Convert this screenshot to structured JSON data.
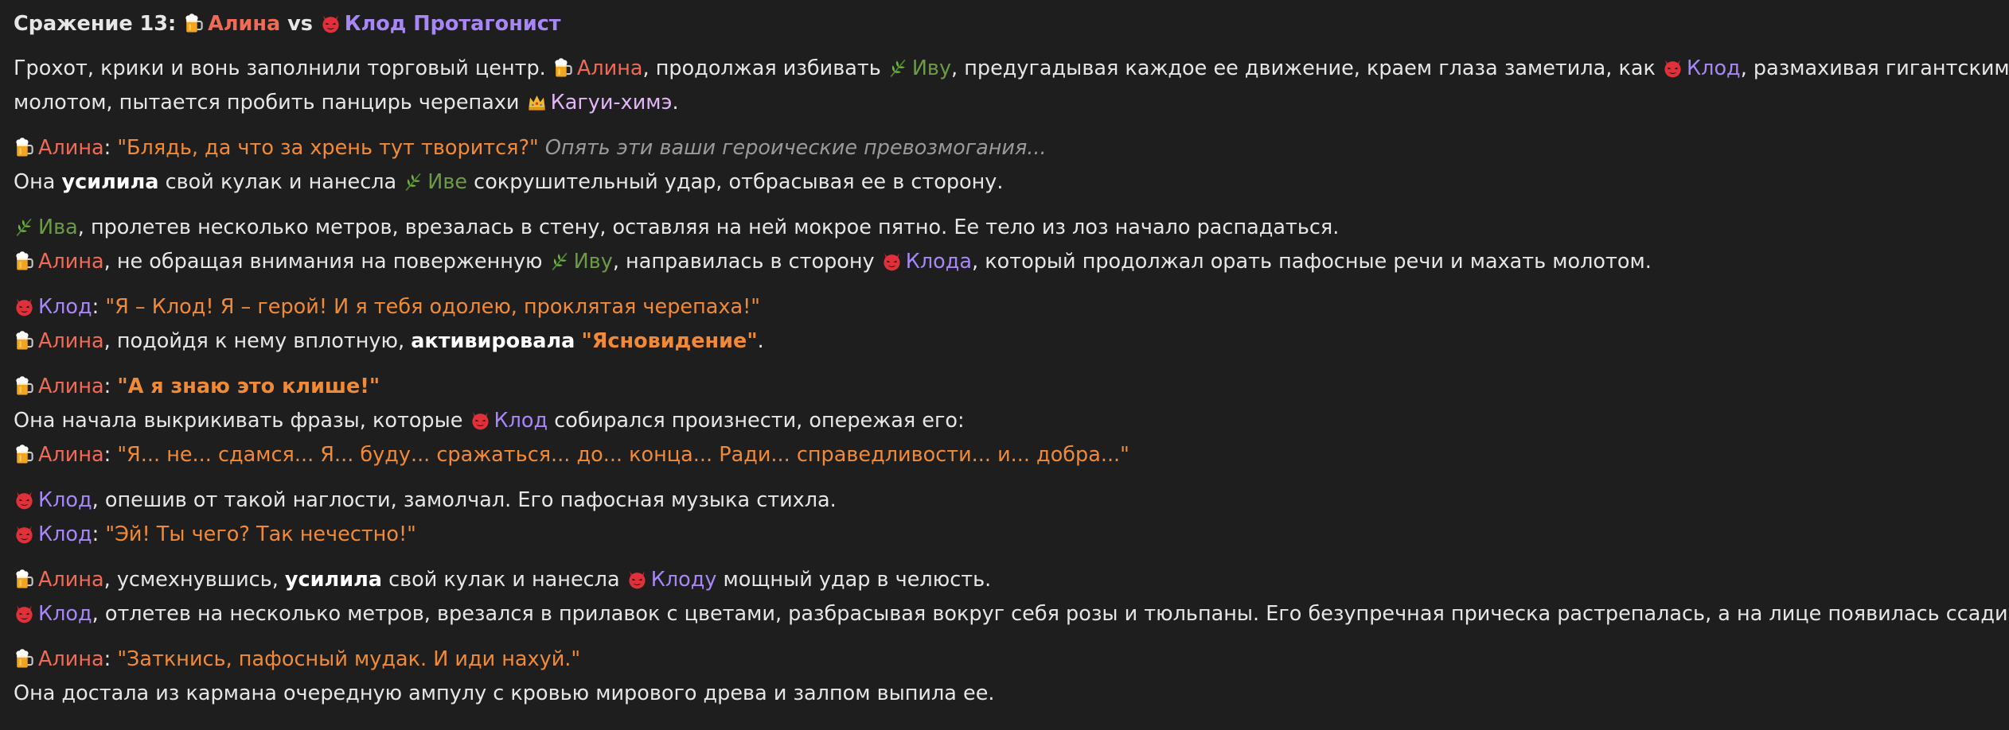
{
  "colors": {
    "background": "#1e1e1f",
    "text": "#e6e6e6",
    "alina": "#f06a55",
    "klod": "#a787f5",
    "iva": "#6d9a46",
    "kaguya": "#e2b5f5",
    "quote": "#f08a36",
    "thought": "#9a9a9a"
  },
  "icons": {
    "alina": "beer-mug-icon",
    "klod": "red-devil-icon",
    "iva": "leaf-icon",
    "kaguya": "crown-icon"
  },
  "battle": {
    "title_prefix": "Сражение 13: ",
    "fighter1": "Алина",
    "vs": " vs ",
    "fighter2": "Клод Протагонист"
  },
  "paragraphs": [
    [
      [
        {
          "t": "text",
          "v": "Грохот, крики и вонь заполнили торговый центр. "
        },
        {
          "t": "alina",
          "v": "Алина"
        },
        {
          "t": "text",
          "v": ", продолжая избивать "
        },
        {
          "t": "iva",
          "v": "Иву"
        },
        {
          "t": "text",
          "v": ", предугадывая каждое ее движение, краем глаза заметила, как "
        },
        {
          "t": "klod",
          "v": "Клод"
        },
        {
          "t": "text",
          "v": ", размахивая гигантским"
        }
      ],
      [
        {
          "t": "text",
          "v": "молотом, пытается пробить панцирь черепахи "
        },
        {
          "t": "kaguya",
          "v": "Кагуи-химэ"
        },
        {
          "t": "text",
          "v": "."
        }
      ]
    ],
    [
      [
        {
          "t": "alina",
          "v": "Алина"
        },
        {
          "t": "text",
          "v": ": "
        },
        {
          "t": "quote",
          "v": "\"Блядь, да что за хрень тут творится?\""
        },
        {
          "t": "text",
          "v": " "
        },
        {
          "t": "thought",
          "v": "Опять эти ваши героические превозмогания..."
        }
      ],
      [
        {
          "t": "text",
          "v": "Она "
        },
        {
          "t": "bold",
          "v": "усилила"
        },
        {
          "t": "text",
          "v": " свой кулак и нанесла "
        },
        {
          "t": "iva",
          "v": "Иве"
        },
        {
          "t": "text",
          "v": " сокрушительный удар, отбрасывая ее в сторону."
        }
      ]
    ],
    [
      [
        {
          "t": "iva",
          "v": "Ива"
        },
        {
          "t": "text",
          "v": ", пролетев несколько метров, врезалась в стену, оставляя на ней мокрое пятно. Ее тело из лоз начало распадаться."
        }
      ],
      [
        {
          "t": "alina",
          "v": "Алина"
        },
        {
          "t": "text",
          "v": ", не обращая внимания на поверженную "
        },
        {
          "t": "iva",
          "v": "Иву"
        },
        {
          "t": "text",
          "v": ", направилась в сторону "
        },
        {
          "t": "klod",
          "v": "Клода"
        },
        {
          "t": "text",
          "v": ", который продолжал орать пафосные речи и махать молотом."
        }
      ]
    ],
    [
      [
        {
          "t": "klod",
          "v": "Клод"
        },
        {
          "t": "text",
          "v": ": "
        },
        {
          "t": "quote",
          "v": "\"Я – Клод! Я – герой! И я тебя одолею, проклятая черепаха!\""
        }
      ],
      [
        {
          "t": "alina",
          "v": "Алина"
        },
        {
          "t": "text",
          "v": ", подойдя к нему вплотную, "
        },
        {
          "t": "bold",
          "v": "активировала"
        },
        {
          "t": "text",
          "v": " "
        },
        {
          "t": "bq",
          "v": "\"Ясновидение\""
        },
        {
          "t": "text",
          "v": "."
        }
      ]
    ],
    [
      [
        {
          "t": "alina",
          "v": "Алина"
        },
        {
          "t": "text",
          "v": ": "
        },
        {
          "t": "bq",
          "v": "\"А я знаю это клише!\""
        }
      ],
      [
        {
          "t": "text",
          "v": "Она начала выкрикивать фразы, которые "
        },
        {
          "t": "klod",
          "v": "Клод"
        },
        {
          "t": "text",
          "v": " собирался произнести, опережая его:"
        }
      ],
      [
        {
          "t": "alina",
          "v": "Алина"
        },
        {
          "t": "text",
          "v": ": "
        },
        {
          "t": "quote",
          "v": "\"Я... не... сдамся... Я... буду... сражаться... до... конца... Ради... справедливости... и... добра...\""
        }
      ]
    ],
    [
      [
        {
          "t": "klod",
          "v": "Клод"
        },
        {
          "t": "text",
          "v": ", опешив от такой наглости, замолчал. Его пафосная музыка стихла."
        }
      ],
      [
        {
          "t": "klod",
          "v": "Клод"
        },
        {
          "t": "text",
          "v": ": "
        },
        {
          "t": "quote",
          "v": "\"Эй! Ты чего? Так нечестно!\""
        }
      ]
    ],
    [
      [
        {
          "t": "alina",
          "v": "Алина"
        },
        {
          "t": "text",
          "v": ", усмехнувшись, "
        },
        {
          "t": "bold",
          "v": "усилила"
        },
        {
          "t": "text",
          "v": " свой кулак и нанесла "
        },
        {
          "t": "klod",
          "v": "Клоду"
        },
        {
          "t": "text",
          "v": " мощный удар в челюсть."
        }
      ],
      [
        {
          "t": "klod",
          "v": "Клод"
        },
        {
          "t": "text",
          "v": ", отлетев на несколько метров, врезался в прилавок с цветами, разбрасывая вокруг себя розы и тюльпаны. Его безупречная прическа растрепалась, а на лице появилась ссадина."
        }
      ]
    ],
    [
      [
        {
          "t": "alina",
          "v": "Алина"
        },
        {
          "t": "text",
          "v": ": "
        },
        {
          "t": "quote",
          "v": "\"Заткнись, пафосный мудак. И иди нахуй.\""
        }
      ],
      [
        {
          "t": "text",
          "v": "Она достала из кармана очередную ампулу с кровью мирового древа и залпом выпила ее."
        }
      ]
    ]
  ]
}
